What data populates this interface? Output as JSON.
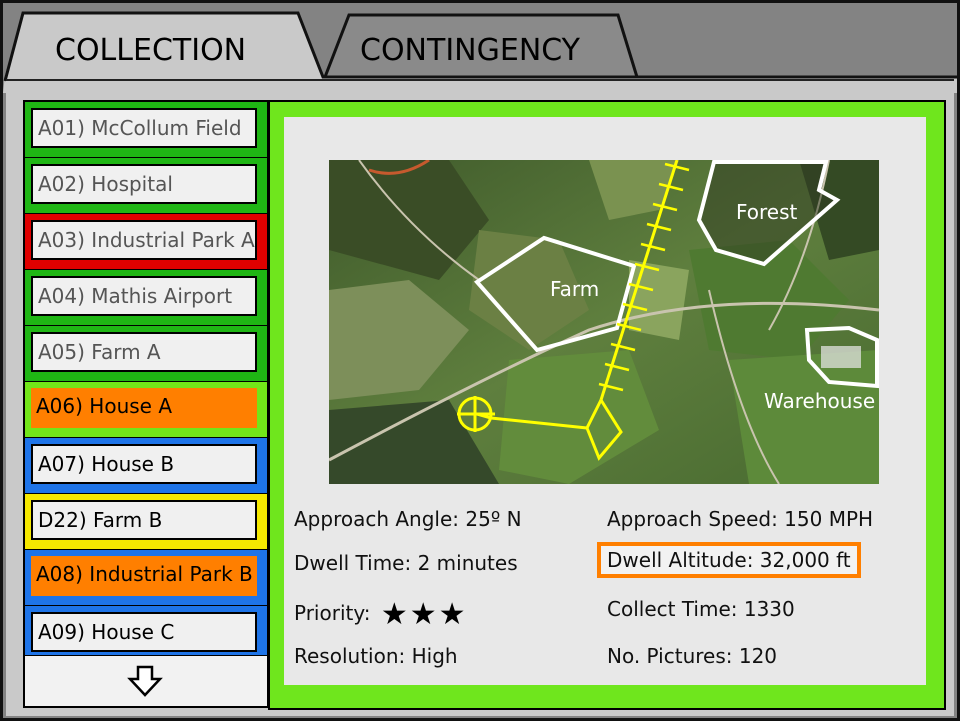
{
  "tabs": [
    {
      "label": "COLLECTION",
      "active": true
    },
    {
      "label": "CONTINGENCY",
      "active": false
    }
  ],
  "list": {
    "items": [
      {
        "label": "A01) McCollum Field",
        "status_color": "#1fb614"
      },
      {
        "label": "A02) Hospital",
        "status_color": "#1fb614"
      },
      {
        "label": "A03) Industrial Park A",
        "status_color": "#e00000"
      },
      {
        "label": "A04) Mathis Airport",
        "status_color": "#1fb614"
      },
      {
        "label": "A05) Farm A",
        "status_color": "#1fb614"
      },
      {
        "label": "A06) House A",
        "status_color": "#ff7f00",
        "selected": true
      },
      {
        "label": "A07) House B",
        "status_color": "#1e74e8"
      },
      {
        "label": "D22) Farm B",
        "status_color": "#f5e800"
      },
      {
        "label": "A08) Industrial Park B",
        "status_color": "#1e74e8",
        "highlight_color": "#ff7f00"
      },
      {
        "label": "A09) House C",
        "status_color": "#1e74e8"
      }
    ],
    "scroll_icon": "arrow-down-icon"
  },
  "map": {
    "labels": {
      "forest": "Forest",
      "farm": "Farm",
      "warehouse": "Warehouse"
    },
    "route_color": "#ffff00",
    "area_outline_color": "#ffffff"
  },
  "details": {
    "approach_angle": "Approach Angle: 25º N",
    "approach_speed": "Approach Speed: 150 MPH",
    "dwell_time": "Dwell Time: 2 minutes",
    "dwell_altitude": "Dwell Altitude: 32,000 ft",
    "priority_label": "Priority:",
    "priority_stars": 3,
    "collect_time": "Collect Time: 1330",
    "resolution": "Resolution: High",
    "no_pictures": "No. Pictures: 120"
  },
  "colors": {
    "selected_panel": "#6fe61d",
    "highlight": "#ff7f00"
  }
}
